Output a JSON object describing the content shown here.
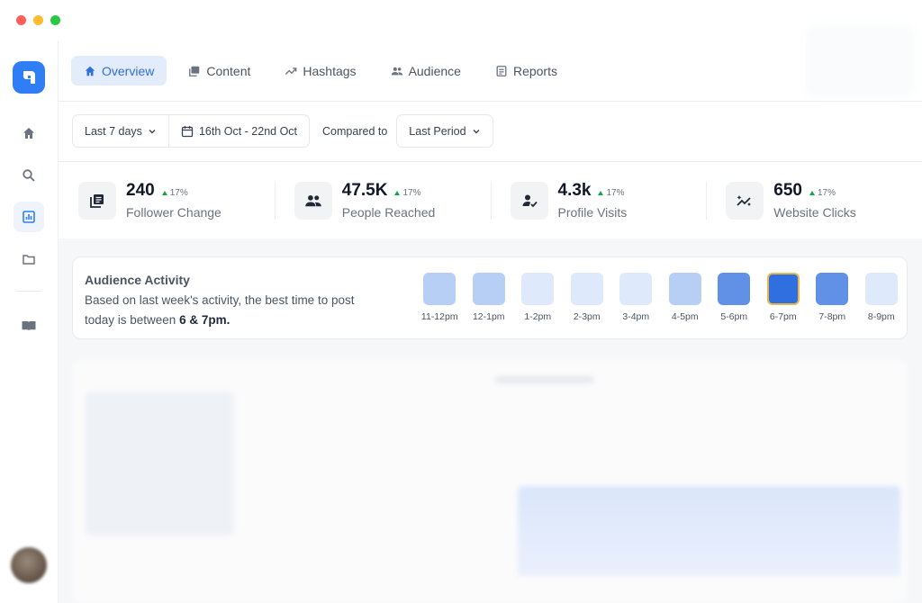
{
  "nav": {
    "tabs": [
      {
        "label": "Overview",
        "icon": "home-icon",
        "active": true
      },
      {
        "label": "Content",
        "icon": "image-gallery-icon",
        "active": false
      },
      {
        "label": "Hashtags",
        "icon": "trending-up-icon",
        "active": false
      },
      {
        "label": "Audience",
        "icon": "people-icon",
        "active": false
      },
      {
        "label": "Reports",
        "icon": "report-icon",
        "active": false
      }
    ]
  },
  "sidebar": {
    "items": [
      "home-icon",
      "search-icon",
      "analytics-icon",
      "folder-icon",
      "book-icon"
    ],
    "active": "analytics-icon"
  },
  "filters": {
    "range": "Last 7 days",
    "dates": "16th Oct - 22nd Oct",
    "compared_label": "Compared to",
    "compared_value": "Last Period"
  },
  "stats": [
    {
      "value": "240",
      "change": "17%",
      "label": "Follower Change",
      "icon": "feed-icon"
    },
    {
      "value": "47.5K",
      "change": "17%",
      "label": "People Reached",
      "icon": "people-icon"
    },
    {
      "value": "4.3k",
      "change": "17%",
      "label": "Profile  Visits",
      "icon": "person-check-icon"
    },
    {
      "value": "650",
      "change": "17%",
      "label": "Website Clicks",
      "icon": "sparkle-trend-icon"
    }
  ],
  "audience": {
    "title": "Audience Activity",
    "desc_prefix": "Based on last week's activity, the best time to post today is between ",
    "desc_highlight": "6 & 7pm.",
    "slots": [
      {
        "label": "11-12pm",
        "level": 0.3
      },
      {
        "label": "12-1pm",
        "level": 0.3
      },
      {
        "label": "1-2pm",
        "level": 0.1
      },
      {
        "label": "2-3pm",
        "level": 0.1
      },
      {
        "label": "3-4pm",
        "level": 0.1
      },
      {
        "label": "4-5pm",
        "level": 0.3
      },
      {
        "label": "5-6pm",
        "level": 0.75
      },
      {
        "label": "6-7pm",
        "level": 1.0,
        "best": true
      },
      {
        "label": "7-8pm",
        "level": 0.75
      },
      {
        "label": "8-9pm",
        "level": 0.1
      }
    ]
  },
  "colors": {
    "accent": "#2f7ef6",
    "best_border": "#e8b84b",
    "positive": "#16a34a"
  }
}
